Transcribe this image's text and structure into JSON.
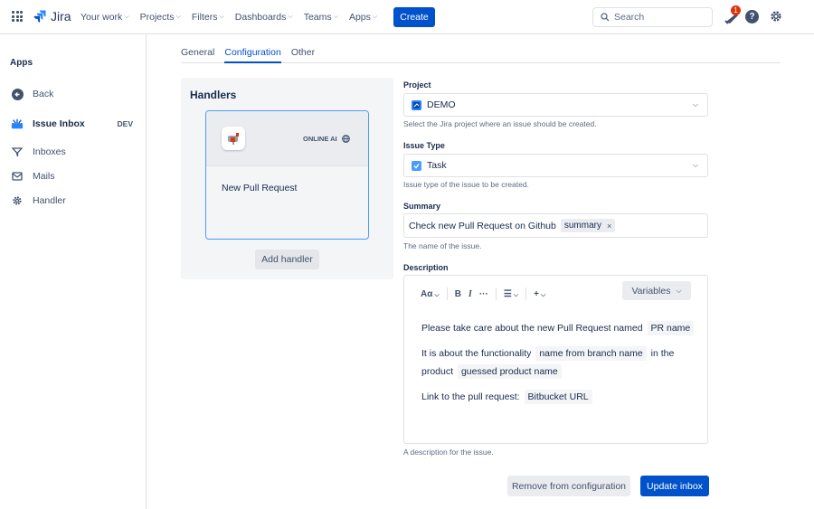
{
  "topnav": {
    "logo": "Jira",
    "items": [
      "Your work",
      "Projects",
      "Filters",
      "Dashboards",
      "Teams",
      "Apps"
    ],
    "create": "Create",
    "search_placeholder": "Search",
    "notification_count": "1"
  },
  "sidebar": {
    "title": "Apps",
    "back": "Back",
    "app_name": "Issue Inbox",
    "app_badge": "DEV",
    "items": [
      "Inboxes",
      "Mails",
      "Handler"
    ]
  },
  "tabs": [
    "General",
    "Configuration",
    "Other"
  ],
  "handlers": {
    "title": "Handlers",
    "card": {
      "tag": "ONLINE AI",
      "name": "New Pull Request"
    },
    "add": "Add handler"
  },
  "form": {
    "project": {
      "label": "Project",
      "value": "DEMO",
      "help": "Select the Jira project where an issue should be created."
    },
    "issue_type": {
      "label": "Issue Type",
      "value": "Task",
      "help": "Issue type of the issue to be created."
    },
    "summary": {
      "label": "Summary",
      "text": "Check new Pull Request on Github",
      "chip": "summary",
      "help": "The name of the issue."
    },
    "description": {
      "label": "Description",
      "toolbar": {
        "text_style": "Aα",
        "bold": "B",
        "italic": "I",
        "more": "···",
        "list": "☰",
        "insert": "+",
        "variables": "Variables"
      },
      "line1": "Please take care about the new Pull Request named",
      "chip1": "PR name",
      "line2a": "It is about the functionality",
      "chip2": "name from branch name",
      "line2b": "in the product",
      "chip3": "guessed product name",
      "line3": "Link to the pull request:",
      "chip4": "Bitbucket URL",
      "help": "A description for the issue."
    }
  },
  "actions": {
    "remove": "Remove from configuration",
    "update": "Update inbox"
  },
  "colors": {
    "primary": "#0052cc",
    "notification": "#de350b"
  }
}
